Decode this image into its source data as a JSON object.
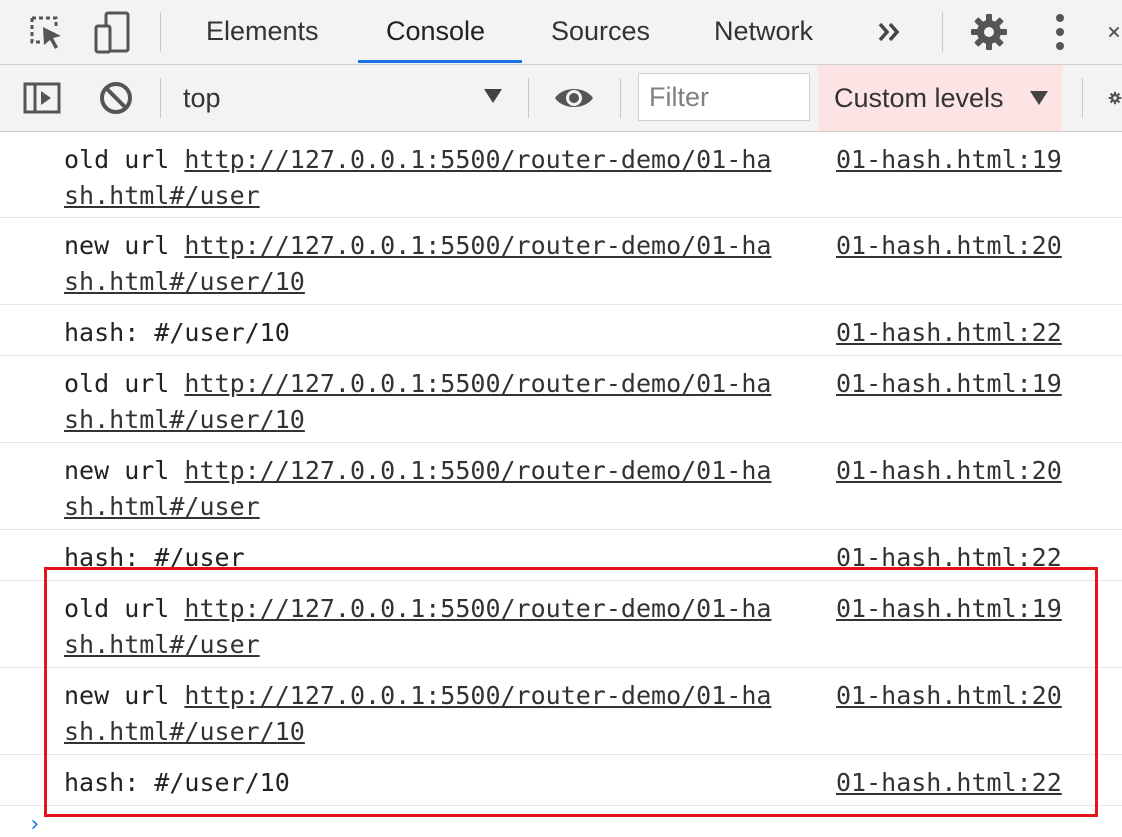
{
  "tabs": [
    {
      "label": "Elements"
    },
    {
      "label": "Console"
    },
    {
      "label": "Sources"
    },
    {
      "label": "Network"
    }
  ],
  "icons": {
    "inspect": "cursor-select-icon",
    "device": "device-toggle-icon",
    "more_tabs": "double-chevron-icon",
    "settings": "gear-icon",
    "menu": "kebab-menu-icon",
    "close": "close-icon",
    "sidebar": "sidebar-toggle-icon",
    "clear": "clear-console-icon",
    "live": "eye-icon",
    "console_settings": "gear-icon"
  },
  "toolbar": {
    "context": "top",
    "filter_placeholder": "Filter",
    "levels_label": "Custom levels"
  },
  "console": {
    "rows": [
      {
        "prefix": "old url ",
        "url1": "http://127.0.0.1:5500/router-demo/01-ha",
        "url2": "sh.html#/user",
        "source": "01-hash.html:19"
      },
      {
        "prefix": "new url ",
        "url1": "http://127.0.0.1:5500/router-demo/01-ha",
        "url2": "sh.html#/user/10",
        "source": "01-hash.html:20"
      },
      {
        "prefix": "hash: #/user/10",
        "source": "01-hash.html:22"
      },
      {
        "prefix": "old url ",
        "url1": "http://127.0.0.1:5500/router-demo/01-ha",
        "url2": "sh.html#/user/10",
        "source": "01-hash.html:19"
      },
      {
        "prefix": "new url ",
        "url1": "http://127.0.0.1:5500/router-demo/01-ha",
        "url2": "sh.html#/user",
        "source": "01-hash.html:20"
      },
      {
        "prefix": "hash: #/user",
        "source": "01-hash.html:22"
      },
      {
        "prefix": "old url ",
        "url1": "http://127.0.0.1:5500/router-demo/01-ha",
        "url2": "sh.html#/user",
        "source": "01-hash.html:19"
      },
      {
        "prefix": "new url ",
        "url1": "http://127.0.0.1:5500/router-demo/01-ha",
        "url2": "sh.html#/user/10",
        "source": "01-hash.html:20"
      },
      {
        "prefix": "hash: #/user/10",
        "source": "01-hash.html:22"
      }
    ],
    "prompt": "›"
  },
  "colors": {
    "accent": "#1a73e8",
    "highlight_border": "#e3141c",
    "levels_bg": "#fde4e4"
  }
}
